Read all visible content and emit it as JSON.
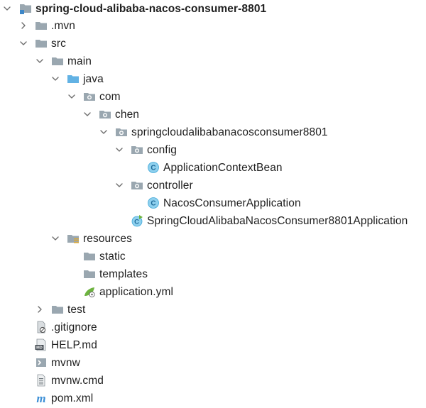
{
  "tree": {
    "root": {
      "label": "spring-cloud-alibaba-nacos-consumer-8801",
      "icon": "module-folder-icon",
      "expanded": true
    },
    "mvn": {
      "label": ".mvn",
      "icon": "folder-icon",
      "expanded": false
    },
    "src": {
      "label": "src",
      "icon": "folder-icon",
      "expanded": true
    },
    "main": {
      "label": "main",
      "icon": "folder-icon",
      "expanded": true
    },
    "java": {
      "label": "java",
      "icon": "source-root-folder-icon",
      "expanded": true
    },
    "com": {
      "label": "com",
      "icon": "package-icon",
      "expanded": true
    },
    "chen": {
      "label": "chen",
      "icon": "package-icon",
      "expanded": true
    },
    "pkg": {
      "label": "springcloudalibabanacosconsumer8801",
      "icon": "package-icon",
      "expanded": true
    },
    "config": {
      "label": "config",
      "icon": "package-icon",
      "expanded": true
    },
    "app_ctx_bean": {
      "label": "ApplicationContextBean",
      "icon": "class-icon"
    },
    "controller": {
      "label": "controller",
      "icon": "package-icon",
      "expanded": true
    },
    "nacos_consumer_app": {
      "label": "NacosConsumerApplication",
      "icon": "class-icon"
    },
    "main_app": {
      "label": "SpringCloudAlibabaNacosConsumer8801Application",
      "icon": "spring-boot-class-icon"
    },
    "resources": {
      "label": "resources",
      "icon": "resources-root-folder-icon",
      "expanded": true
    },
    "static": {
      "label": "static",
      "icon": "folder-icon"
    },
    "templates": {
      "label": "templates",
      "icon": "folder-icon"
    },
    "app_yml": {
      "label": "application.yml",
      "icon": "spring-yml-icon"
    },
    "test": {
      "label": "test",
      "icon": "folder-icon",
      "expanded": false
    },
    "gitignore": {
      "label": ".gitignore",
      "icon": "ignore-file-icon"
    },
    "help": {
      "label": "HELP.md",
      "icon": "markdown-icon"
    },
    "mvnw": {
      "label": "mvnw",
      "icon": "shell-script-icon"
    },
    "mvnw_cmd": {
      "label": "mvnw.cmd",
      "icon": "text-file-icon"
    },
    "pom": {
      "label": "pom.xml",
      "icon": "maven-icon"
    }
  },
  "colors": {
    "folder": "#9aa7b0",
    "source_root": "#62b2e4",
    "class": "#40a8d8",
    "spring": "#6db33f",
    "chevron": "#6e6e6e",
    "text": "#1f1f1f"
  }
}
